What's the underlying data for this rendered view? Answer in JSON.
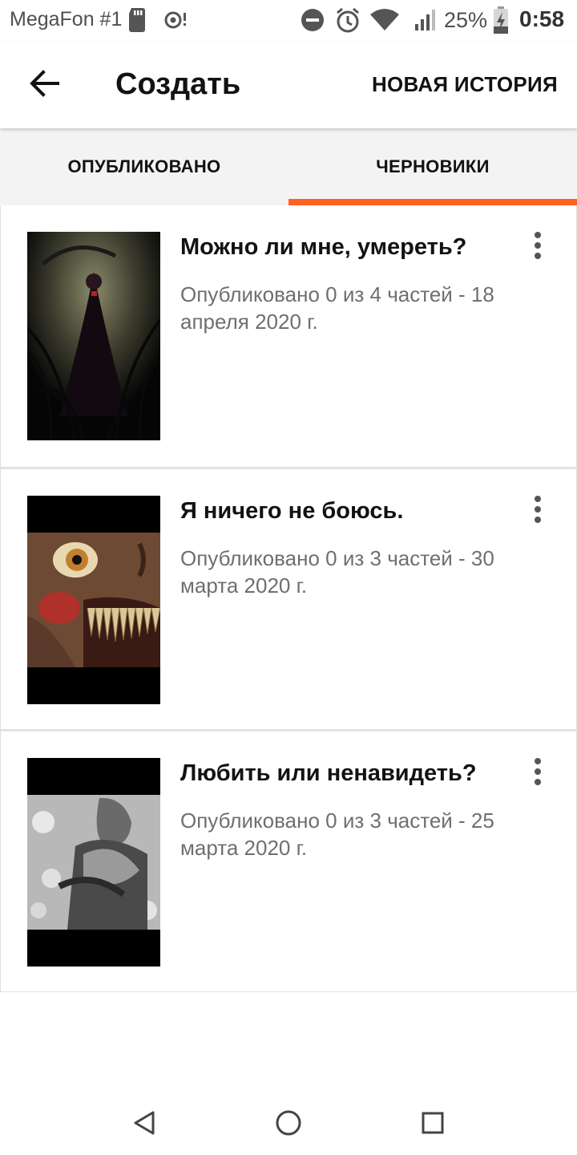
{
  "status_bar": {
    "carrier": "MegaFon #1",
    "battery_percent": "25%",
    "time": "0:58",
    "icons": [
      "sd-card-icon",
      "hotspot-icon",
      "dnd-icon",
      "alarm-icon",
      "wifi-icon",
      "signal-icon",
      "battery-charging-icon"
    ]
  },
  "app_bar": {
    "title": "Создать",
    "action_label": "НОВАЯ ИСТОРИЯ",
    "back_icon": "arrow-left-icon"
  },
  "tabs": [
    {
      "label": "ОПУБЛИКОВАНО",
      "active": false
    },
    {
      "label": "ЧЕРНОВИКИ",
      "active": true
    }
  ],
  "accent_color": "#ff6122",
  "stories": [
    {
      "title": "Можно ли мне, умереть?",
      "meta": "Опубликовано 0 из 4 частей - 18 апреля 2020 г.",
      "cover_icon": "cover-dark-figure-image"
    },
    {
      "title": "Я ничего не боюсь.",
      "meta": "Опубликовано 0 из 3 частей - 30 марта 2020 г.",
      "cover_icon": "cover-monster-face-image"
    },
    {
      "title": "Любить или ненавидеть?",
      "meta": "Опубликовано 0 из 3 частей - 25 марта 2020 г.",
      "cover_icon": "cover-embrace-image"
    }
  ],
  "nav_bar": {
    "icons": [
      "nav-back-icon",
      "nav-home-icon",
      "nav-recents-icon"
    ]
  }
}
